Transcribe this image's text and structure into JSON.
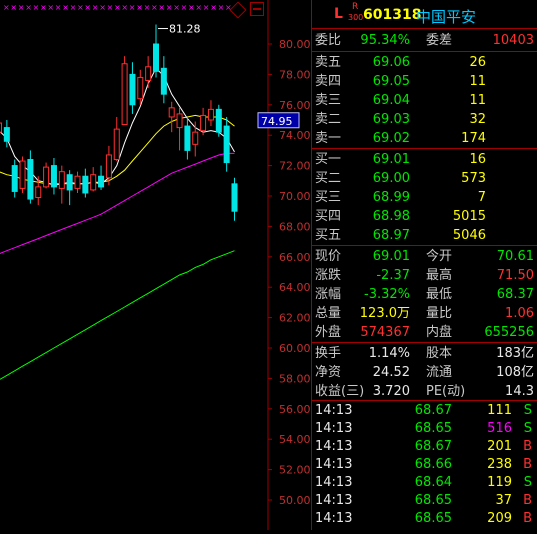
{
  "header": {
    "level_icon": "L",
    "badge_top": "R",
    "badge_bottom": "300",
    "code": "601318",
    "name": "中国平安"
  },
  "order_ratio": {
    "label": "委比",
    "value": "95.34%",
    "diff_label": "委差",
    "diff_value": "10403"
  },
  "asks": [
    {
      "label": "卖五",
      "price": "69.06",
      "volume": "26"
    },
    {
      "label": "卖四",
      "price": "69.05",
      "volume": "11"
    },
    {
      "label": "卖三",
      "price": "69.04",
      "volume": "11"
    },
    {
      "label": "卖二",
      "price": "69.03",
      "volume": "32"
    },
    {
      "label": "卖一",
      "price": "69.02",
      "volume": "174"
    }
  ],
  "bids": [
    {
      "label": "买一",
      "price": "69.01",
      "volume": "16"
    },
    {
      "label": "买二",
      "price": "69.00",
      "volume": "573"
    },
    {
      "label": "买三",
      "price": "68.99",
      "volume": "7"
    },
    {
      "label": "买四",
      "price": "68.98",
      "volume": "5015"
    },
    {
      "label": "买五",
      "price": "68.97",
      "volume": "5046"
    }
  ],
  "quote": [
    {
      "l1": "现价",
      "v1": "69.01",
      "c1": "green",
      "l2": "今开",
      "v2": "70.61",
      "c2": "green"
    },
    {
      "l1": "涨跌",
      "v1": "-2.37",
      "c1": "green",
      "l2": "最高",
      "v2": "71.50",
      "c2": "red"
    },
    {
      "l1": "涨幅",
      "v1": "-3.32%",
      "c1": "green",
      "l2": "最低",
      "v2": "68.37",
      "c2": "green"
    },
    {
      "l1": "总量",
      "v1": "123.0万",
      "c1": "yellow",
      "l2": "量比",
      "v2": "1.06",
      "c2": "red"
    },
    {
      "l1": "外盘",
      "v1": "574367",
      "c1": "red",
      "l2": "内盘",
      "v2": "655256",
      "c2": "green"
    }
  ],
  "fundamentals": [
    {
      "l1": "换手",
      "v1": "1.14%",
      "l2": "股本",
      "v2": "183亿"
    },
    {
      "l1": "净资",
      "v1": "24.52",
      "l2": "流通",
      "v2": "108亿"
    },
    {
      "l1": "收益(三)",
      "v1": "3.720",
      "l2": "PE(动)",
      "v2": "14.3"
    }
  ],
  "ticks": [
    {
      "time": "14:13",
      "price": "68.67",
      "volume": "111",
      "side": "S",
      "vol_color": "yellow",
      "side_color": "green"
    },
    {
      "time": "14:13",
      "price": "68.65",
      "volume": "516",
      "side": "S",
      "vol_color": "magenta",
      "side_color": "green"
    },
    {
      "time": "14:13",
      "price": "68.67",
      "volume": "201",
      "side": "B",
      "vol_color": "yellow",
      "side_color": "red"
    },
    {
      "time": "14:13",
      "price": "68.66",
      "volume": "238",
      "side": "B",
      "vol_color": "yellow",
      "side_color": "red"
    },
    {
      "time": "14:13",
      "price": "68.64",
      "volume": "119",
      "side": "S",
      "vol_color": "yellow",
      "side_color": "green"
    },
    {
      "time": "14:13",
      "price": "68.65",
      "volume": "37",
      "side": "B",
      "vol_color": "yellow",
      "side_color": "red"
    },
    {
      "time": "14:13",
      "price": "68.65",
      "volume": "209",
      "side": "B",
      "vol_color": "yellow",
      "side_color": "red"
    }
  ],
  "chart_data": {
    "type": "line",
    "title": "",
    "y_ticks": [
      "80.00",
      "78.00",
      "76.00",
      "74.00",
      "72.00",
      "70.00",
      "68.00",
      "66.00",
      "64.00",
      "62.00",
      "60.00",
      "58.00",
      "56.00",
      "54.00",
      "52.00",
      "50.00"
    ],
    "ylim": [
      49.7,
      82.7
    ],
    "current_price_label": "74.95",
    "high_annotation": "81.28",
    "candles": [
      {
        "o": 74.2,
        "c": 74.8,
        "h": 75.6,
        "l": 73.5
      },
      {
        "o": 74.5,
        "c": 73.6,
        "h": 75.0,
        "l": 73.2
      },
      {
        "o": 72.0,
        "c": 70.3,
        "h": 72.4,
        "l": 69.9
      },
      {
        "o": 70.5,
        "c": 72.3,
        "h": 72.6,
        "l": 70.2
      },
      {
        "o": 72.4,
        "c": 69.8,
        "h": 73.0,
        "l": 69.5
      },
      {
        "o": 69.9,
        "c": 70.6,
        "h": 71.3,
        "l": 69.4
      },
      {
        "o": 70.6,
        "c": 71.9,
        "h": 72.2,
        "l": 70.5
      },
      {
        "o": 72.0,
        "c": 70.6,
        "h": 72.5,
        "l": 70.1
      },
      {
        "o": 70.5,
        "c": 71.6,
        "h": 72.0,
        "l": 69.5
      },
      {
        "o": 71.4,
        "c": 70.4,
        "h": 71.7,
        "l": 69.4
      },
      {
        "o": 70.5,
        "c": 71.3,
        "h": 71.6,
        "l": 70.2
      },
      {
        "o": 71.3,
        "c": 70.2,
        "h": 71.8,
        "l": 69.9
      },
      {
        "o": 70.4,
        "c": 71.4,
        "h": 71.9,
        "l": 70.3
      },
      {
        "o": 71.3,
        "c": 70.6,
        "h": 72.0,
        "l": 70.4
      },
      {
        "o": 71.2,
        "c": 72.7,
        "h": 73.3,
        "l": 70.7
      },
      {
        "o": 72.4,
        "c": 74.4,
        "h": 75.2,
        "l": 72.3
      },
      {
        "o": 74.7,
        "c": 78.7,
        "h": 79.2,
        "l": 74.7
      },
      {
        "o": 78.0,
        "c": 76.0,
        "h": 78.8,
        "l": 75.4
      },
      {
        "o": 76.4,
        "c": 77.8,
        "h": 78.3,
        "l": 76.0
      },
      {
        "o": 77.6,
        "c": 78.5,
        "h": 79.2,
        "l": 77.1
      },
      {
        "o": 80.0,
        "c": 78.2,
        "h": 81.28,
        "l": 77.8
      },
      {
        "o": 78.4,
        "c": 76.7,
        "h": 79.2,
        "l": 76.1
      },
      {
        "o": 75.2,
        "c": 75.8,
        "h": 76.2,
        "l": 74.2
      },
      {
        "o": 74.5,
        "c": 75.4,
        "h": 75.8,
        "l": 73.0
      },
      {
        "o": 74.6,
        "c": 73.0,
        "h": 75.2,
        "l": 72.4
      },
      {
        "o": 73.4,
        "c": 74.2,
        "h": 74.9,
        "l": 72.6
      },
      {
        "o": 74.3,
        "c": 75.3,
        "h": 75.8,
        "l": 74.0
      },
      {
        "o": 75.0,
        "c": 75.7,
        "h": 76.3,
        "l": 74.6
      },
      {
        "o": 75.7,
        "c": 74.2,
        "h": 76.0,
        "l": 73.9
      },
      {
        "o": 74.6,
        "c": 72.2,
        "h": 75.2,
        "l": 71.6
      },
      {
        "o": 70.8,
        "c": 69.0,
        "h": 71.2,
        "l": 68.37
      }
    ],
    "ma_short": [
      74.3,
      73.8,
      72.6,
      72.0,
      71.6,
      71.0,
      70.9,
      70.7,
      70.8,
      70.9,
      70.8,
      70.8,
      70.9,
      70.8,
      71.2,
      72.0,
      73.5,
      74.8,
      75.9,
      77.4,
      78.4,
      77.9,
      76.7,
      75.9,
      75.1,
      74.5,
      74.2,
      74.3,
      74.2,
      73.8,
      72.9
    ],
    "ma_mid": [
      71.6,
      71.4,
      71.3,
      71.1,
      71.0,
      70.9,
      70.8,
      70.8,
      70.8,
      70.8,
      70.8,
      70.8,
      70.9,
      70.9,
      71.0,
      71.3,
      71.7,
      72.3,
      72.9,
      73.5,
      74.1,
      74.6,
      74.9,
      75.1,
      75.2,
      75.3,
      75.2,
      75.2,
      75.2,
      75.0,
      74.6
    ],
    "ma_long": [
      66.2,
      66.4,
      66.6,
      66.8,
      67.0,
      67.2,
      67.4,
      67.6,
      67.8,
      68.0,
      68.2,
      68.4,
      68.6,
      68.8,
      69.1,
      69.4,
      69.7,
      70.0,
      70.3,
      70.6,
      70.9,
      71.2,
      71.5,
      71.7,
      71.9,
      72.1,
      72.3,
      72.5,
      72.7,
      72.8,
      72.8
    ],
    "ma_xlong": [
      57.9,
      58.2,
      58.5,
      58.8,
      59.1,
      59.4,
      59.7,
      60.0,
      60.3,
      60.6,
      60.9,
      61.2,
      61.5,
      61.8,
      62.1,
      62.4,
      62.7,
      63.0,
      63.3,
      63.6,
      63.9,
      64.2,
      64.5,
      64.8,
      65.0,
      65.3,
      65.5,
      65.8,
      66.0,
      66.2,
      66.4
    ],
    "colors": {
      "up": "#ff3030",
      "down": "#00e6e6",
      "ma_short": "#ffffff",
      "ma_mid": "#ffff00",
      "ma_long": "#ff00ff",
      "ma_xlong": "#00ff00"
    }
  }
}
